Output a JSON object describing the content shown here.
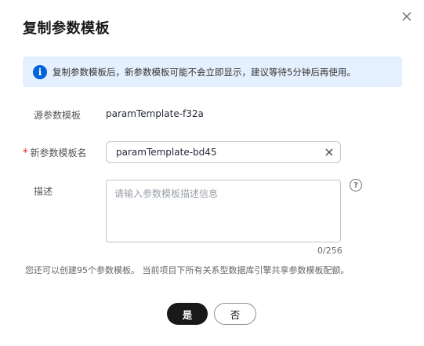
{
  "dialog": {
    "title": "复制参数模板",
    "close_icon": "close-icon"
  },
  "info": {
    "icon": "info-icon",
    "icon_glyph": "i",
    "text": "复制参数模板后，新参数模板可能不会立即显示，建议等待5分钟后再使用。"
  },
  "form": {
    "source_label": "源参数模板",
    "source_value": "paramTemplate-f32a",
    "new_name_required_mark": "*",
    "new_name_label": "新参数模板名",
    "new_name_value": "paramTemplate-bd45",
    "clear_icon": "clear-icon",
    "description_label": "描述",
    "description_placeholder": "请输入参数模板描述信息",
    "description_counter": "0/256",
    "help_icon": "help-icon",
    "help_glyph": "?"
  },
  "quota_note": "您还可以创建95个参数模板。 当前项目下所有关系型数据库引擎共享参数模板配额。",
  "buttons": {
    "confirm_label": "是",
    "cancel_label": "否"
  },
  "colors": {
    "info_background": "#e5f0ff",
    "info_icon": "#0062d9",
    "required": "#e0251b",
    "primary_button": "#191919"
  }
}
